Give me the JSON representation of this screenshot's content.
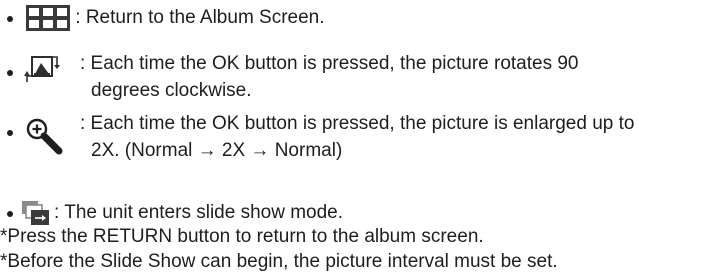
{
  "items": [
    {
      "icon": "album-grid-icon",
      "lines": [
        " : Return to the Album Screen."
      ]
    },
    {
      "icon": "rotate-picture-icon",
      "lines": [
        ": Each time the OK button is pressed, the picture rotates 90",
        "degrees clockwise."
      ]
    },
    {
      "icon": "zoom-magnifier-icon",
      "lines": [
        ": Each time the OK button is pressed, the picture is enlarged up to",
        "2X. (Normal → 2X → Normal)"
      ]
    },
    {
      "icon": "slideshow-icon",
      "lines": [
        ": The unit enters slide show mode."
      ]
    }
  ],
  "notes": [
    "*Press the RETURN button to return to the album screen.",
    "*Before the Slide Show can begin, the picture interval must be set."
  ],
  "colors": {
    "text": "#1e1e1e",
    "icon_dark": "#3a3a3a",
    "icon_mid": "#8a8a8a"
  }
}
